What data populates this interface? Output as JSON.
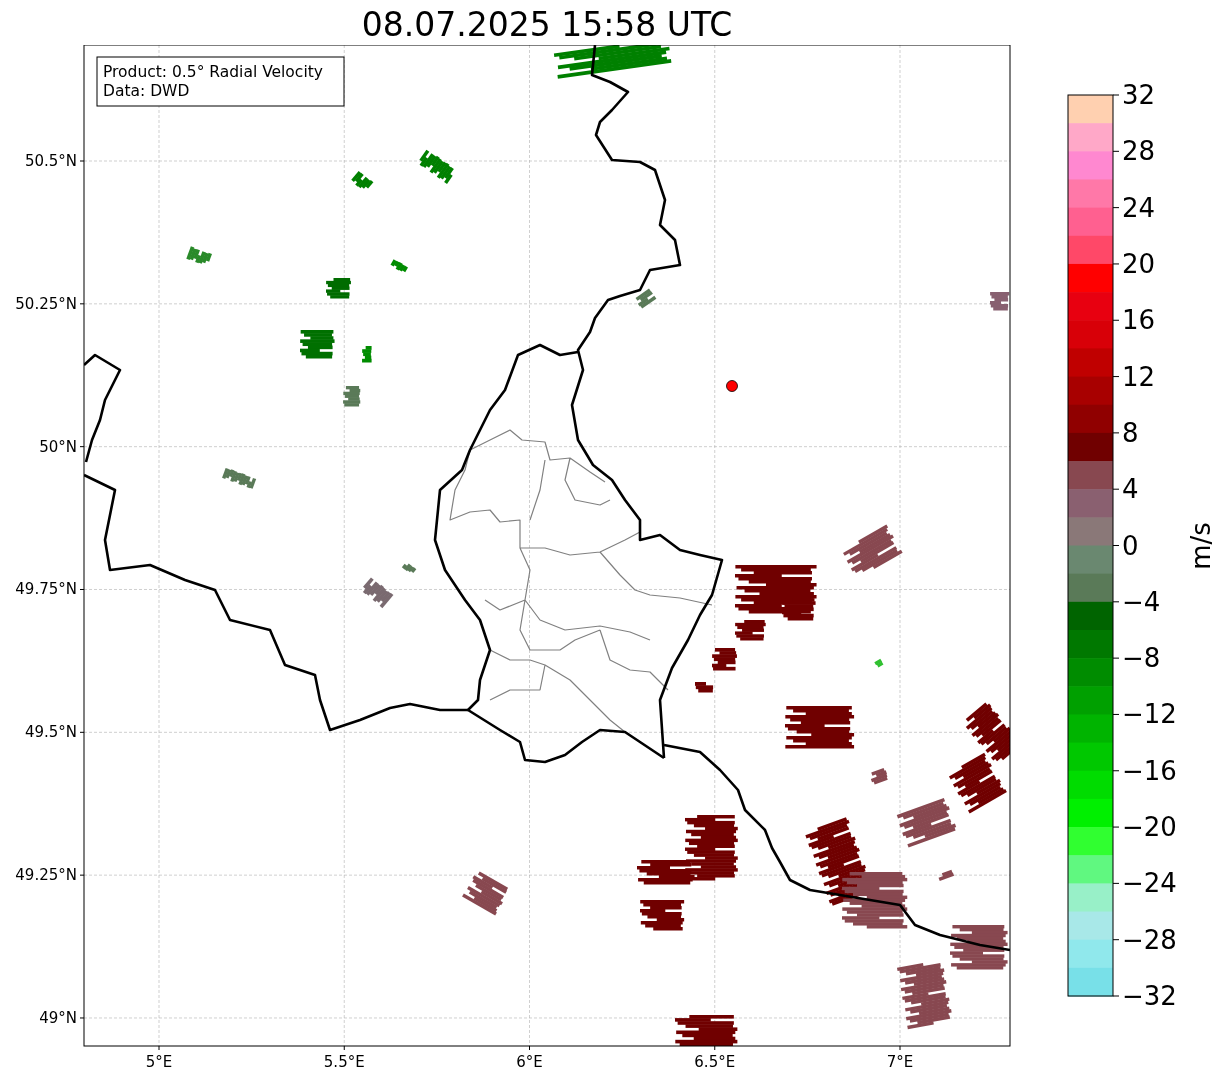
{
  "title": "08.07.2025 15:58 UTC",
  "info_box": {
    "lines": [
      "Product: 0.5° Radial Velocity",
      "Data: DWD"
    ]
  },
  "map": {
    "x_ticks": [
      "5°E",
      "5.5°E",
      "6°E",
      "6.5°E",
      "7°E"
    ],
    "y_ticks": [
      "50.5°N",
      "50.25°N",
      "50°N",
      "49.75°N",
      "49.5°N",
      "49.25°N",
      "49°N"
    ]
  },
  "colorbar": {
    "label": "m/s",
    "ticks": [
      "32",
      "28",
      "24",
      "20",
      "16",
      "12",
      "8",
      "4",
      "0",
      "−4",
      "−8",
      "−12",
      "−16",
      "−20",
      "−24",
      "−28",
      "−32"
    ],
    "segments": [
      {
        "color": "#ffd0b0"
      },
      {
        "color": "#ffa8c8"
      },
      {
        "color": "#ff88d0"
      },
      {
        "color": "#ff78a8"
      },
      {
        "color": "#ff6090"
      },
      {
        "color": "#ff4868"
      },
      {
        "color": "#ff0000"
      },
      {
        "color": "#e80010"
      },
      {
        "color": "#d80008"
      },
      {
        "color": "#c00000"
      },
      {
        "color": "#a80000"
      },
      {
        "color": "#900000"
      },
      {
        "color": "#700000"
      },
      {
        "color": "#884850"
      },
      {
        "color": "#8a6070"
      },
      {
        "color": "#8a7878"
      },
      {
        "color": "#6a8870"
      },
      {
        "color": "#5a7a58"
      },
      {
        "color": "#006400"
      },
      {
        "color": "#007800"
      },
      {
        "color": "#008c00"
      },
      {
        "color": "#00a000"
      },
      {
        "color": "#00b400"
      },
      {
        "color": "#00c800"
      },
      {
        "color": "#00dc00"
      },
      {
        "color": "#00f000"
      },
      {
        "color": "#30ff30"
      },
      {
        "color": "#60f880"
      },
      {
        "color": "#98f0c8"
      },
      {
        "color": "#a8e8e8"
      },
      {
        "color": "#90e8ec"
      },
      {
        "color": "#78e0e8"
      }
    ]
  }
}
